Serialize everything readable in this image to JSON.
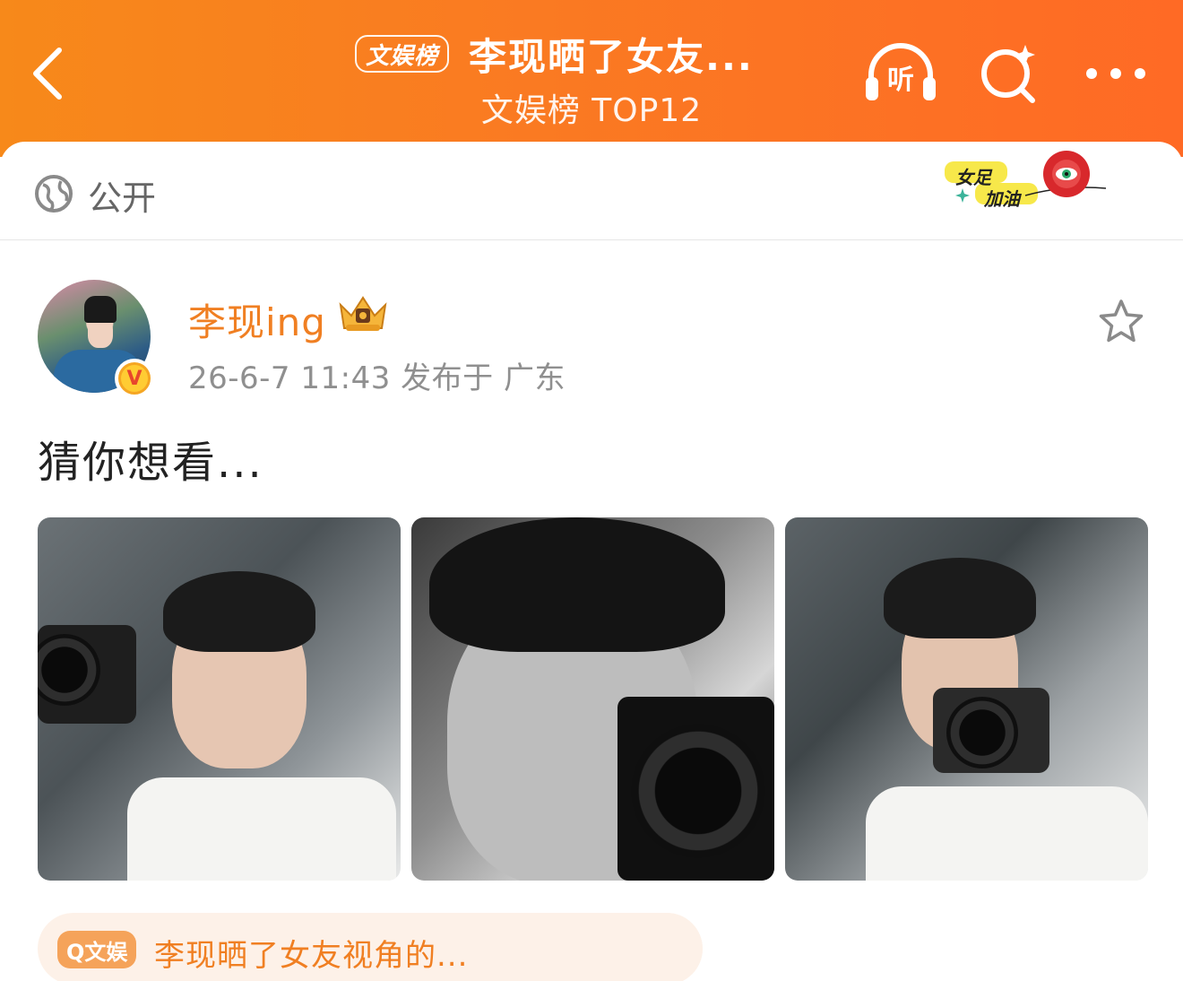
{
  "header": {
    "rank_badge": "文娱榜",
    "title": "李现晒了女友...",
    "subtitle": "文娱榜 TOP12",
    "listen_label": "听"
  },
  "visibility": {
    "label": "公开",
    "sticker_line1": "女足",
    "sticker_line2": "加油"
  },
  "post": {
    "username": "李现ing",
    "meta": "26-6-7 11:43  发布于 广东",
    "verify_mark": "V",
    "text": "猜你想看..."
  },
  "topic": {
    "tag": "Q文娱",
    "text": "李现晒了女友视角的..."
  },
  "colors": {
    "header_start": "#f7891a",
    "header_end": "#ff6a25",
    "accent_orange": "#f07f22",
    "meta_gray": "#8f8f8f"
  }
}
